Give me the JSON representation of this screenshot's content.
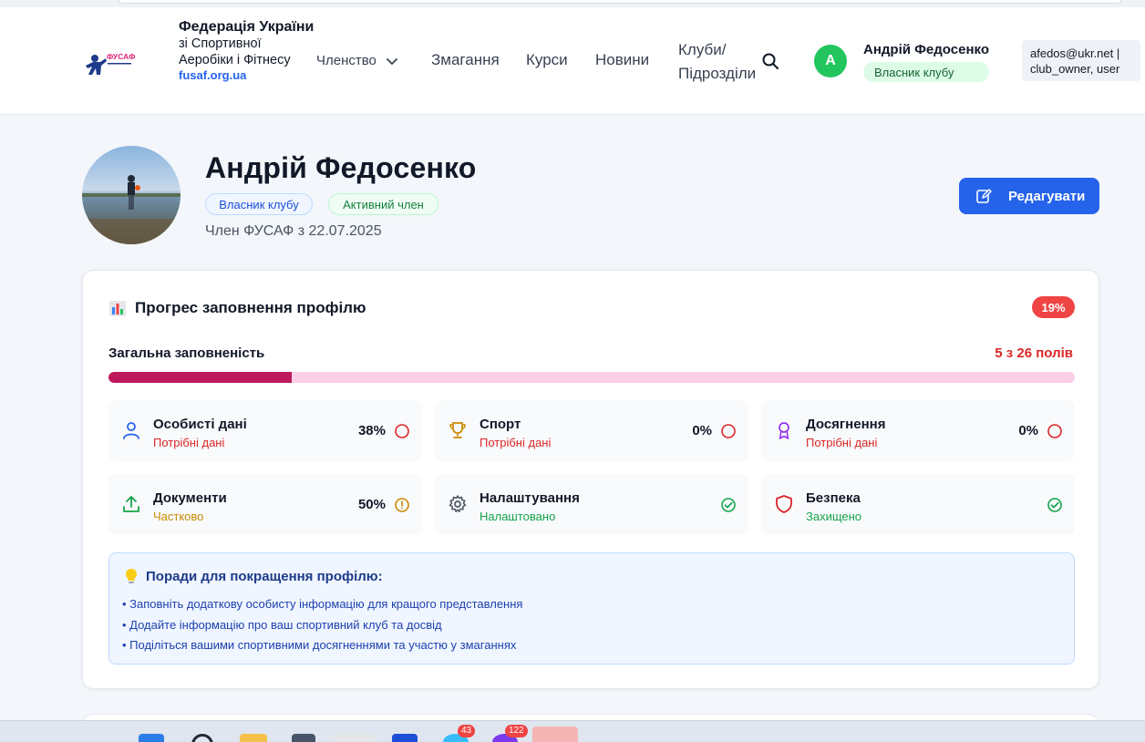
{
  "header": {
    "org_title": "Федерація України",
    "org_subtitle": "зі Спортивної Аеробіки і Фітнесу",
    "org_url": "fusaf.org.ua",
    "logo_text": "ФУСАФ"
  },
  "nav": {
    "membership": "Членство",
    "competitions": "Змагання",
    "courses": "Курси",
    "news": "Новини",
    "clubs_line1": "Клуби/",
    "clubs_line2": "Підрозділи"
  },
  "user": {
    "initial": "А",
    "name": "Андрій Федосенко",
    "role": "Власник клубу",
    "email": "afedos@ukr.net |",
    "roles_raw": "club_owner, user"
  },
  "profile": {
    "name": "Андрій Федосенко",
    "badge_owner": "Власник клубу",
    "badge_active": "Активний член",
    "member_since": "Член ФУСАФ з 22.07.2025",
    "edit_label": "Редагувати"
  },
  "progress": {
    "title": "Прогрес заповнення профілю",
    "percent_label": "19%",
    "overall_label": "Загальна заповненість",
    "overall_count": "5 з 26 полів",
    "fill_fraction": 0.19,
    "sections": [
      {
        "name": "Особисті дані",
        "status": "Потрібні дані",
        "pct": "38%",
        "state": "incomplete",
        "icon": "user-icon"
      },
      {
        "name": "Спорт",
        "status": "Потрібні дані",
        "pct": "0%",
        "state": "incomplete",
        "icon": "trophy-icon"
      },
      {
        "name": "Досягнення",
        "status": "Потрібні дані",
        "pct": "0%",
        "state": "incomplete",
        "icon": "medal-icon"
      },
      {
        "name": "Документи",
        "status": "Частково",
        "pct": "50%",
        "state": "partial",
        "icon": "upload-icon"
      },
      {
        "name": "Налаштування",
        "status": "Налаштовано",
        "pct": "",
        "state": "complete",
        "icon": "gear-icon"
      },
      {
        "name": "Безпека",
        "status": "Захищено",
        "pct": "",
        "state": "complete",
        "icon": "shield-icon"
      }
    ]
  },
  "tips": {
    "title": "Поради для покращення профілю:",
    "items": [
      "• Заповніть додаткову особисту інформацію для кращого представлення",
      "• Додайте інформацію про ваш спортивний клуб та досвід",
      "• Поділіться вашими спортивними досягненнями та участю у змаганнях"
    ]
  },
  "taskbar": {
    "badge_1": "43",
    "badge_2": "122"
  },
  "colors": {
    "primary": "#2563eb",
    "danger": "#ef4444",
    "progress_fill": "#be185d",
    "progress_track": "#fbcfe8",
    "success": "#16a34a",
    "warning": "#ca8a04"
  }
}
